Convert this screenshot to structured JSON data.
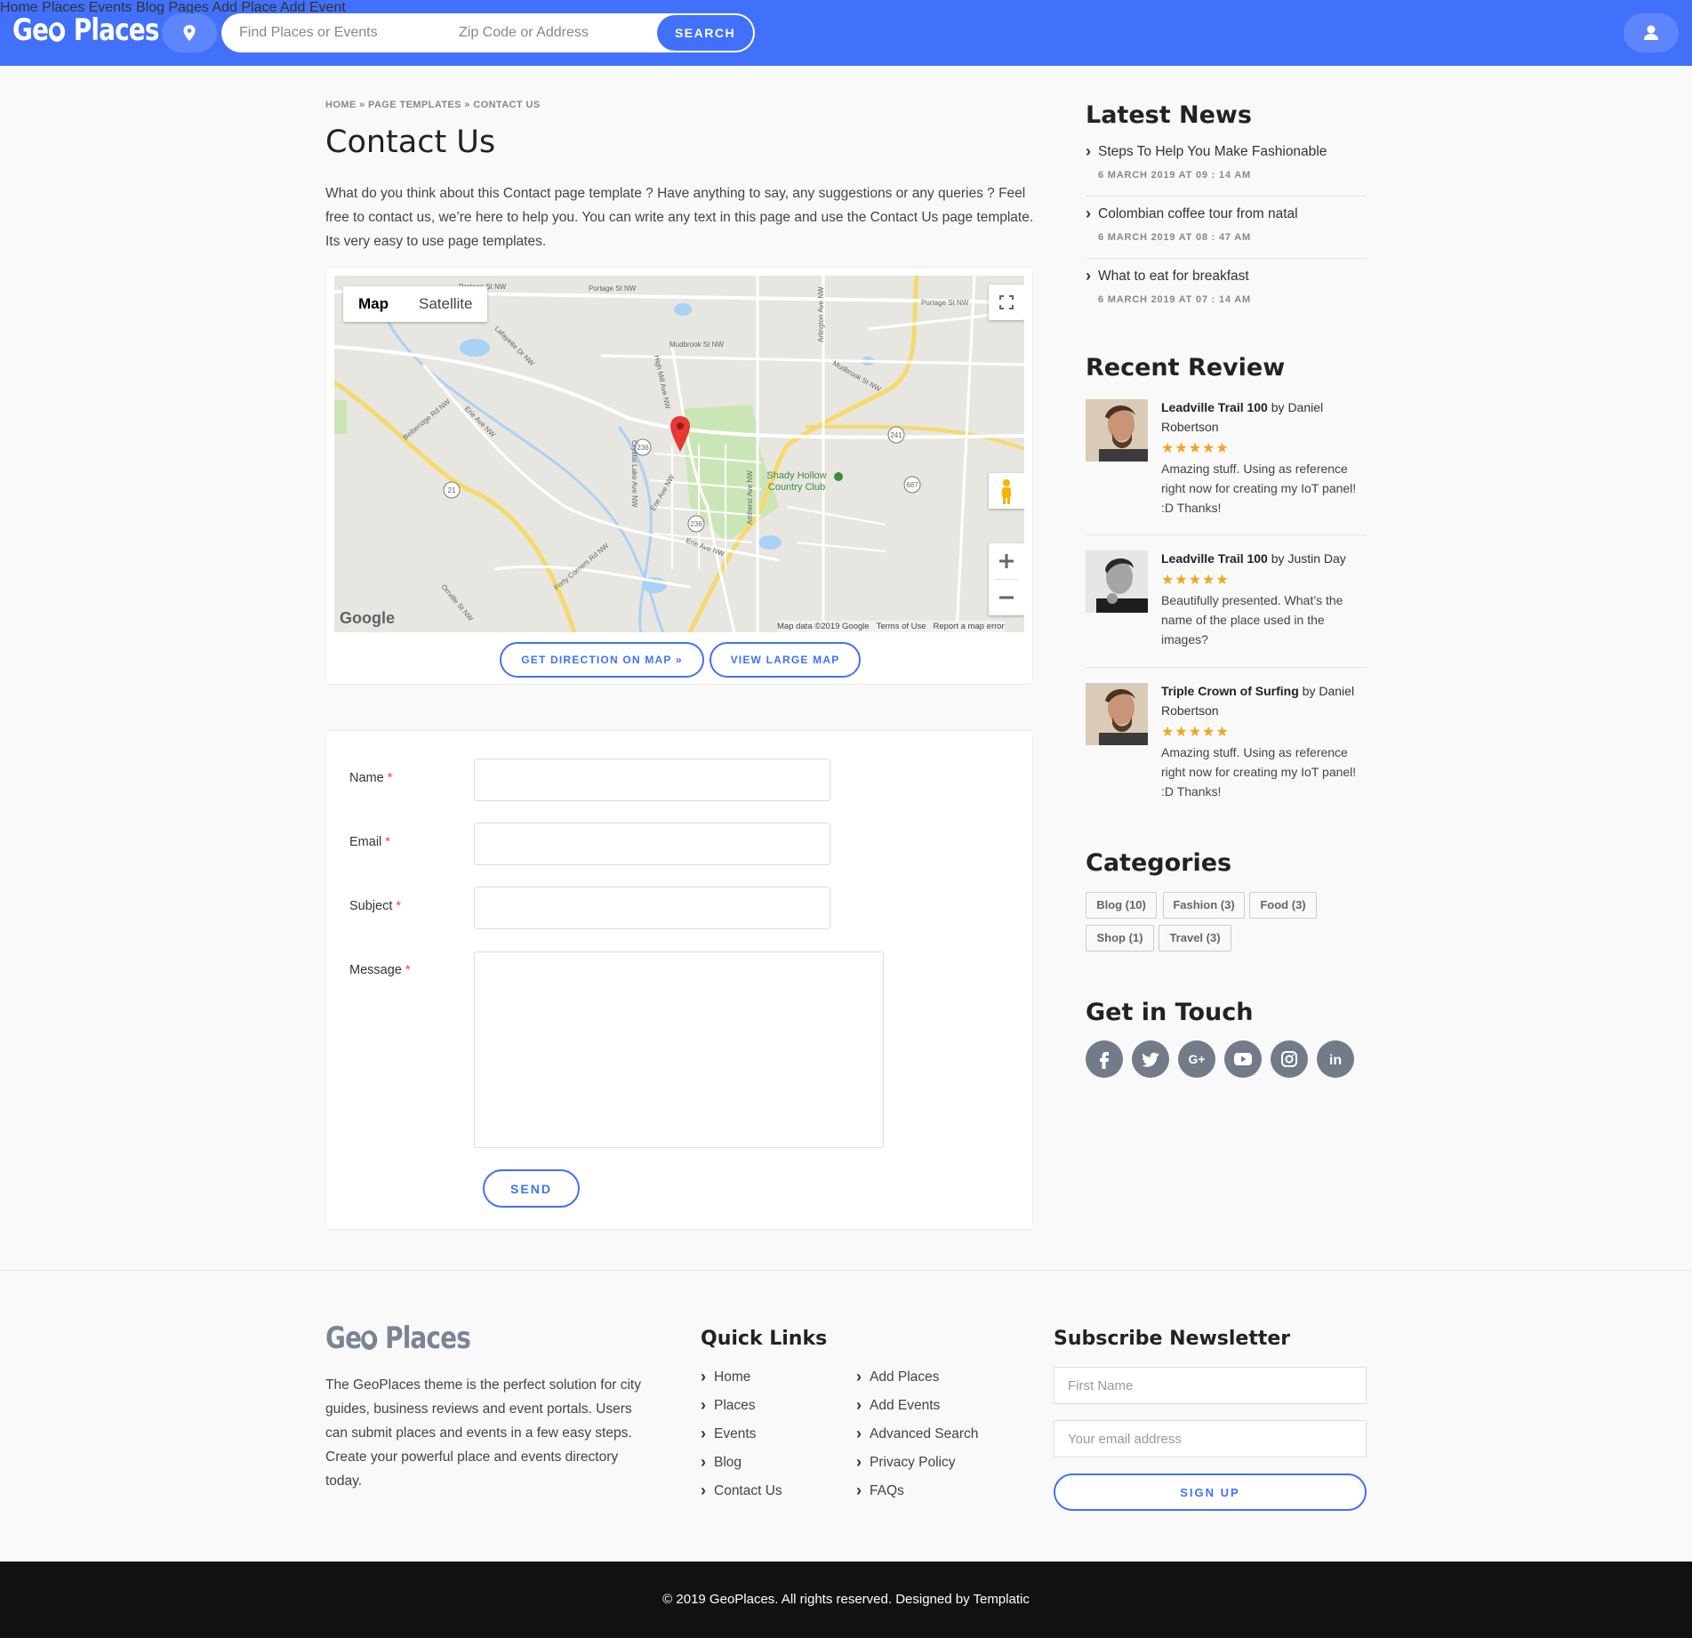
{
  "brand": {
    "logo_left": "Ge",
    "logo_right": "Places"
  },
  "search": {
    "what_placeholder": "Find Places or Events",
    "where_placeholder": "Zip Code or Address",
    "button": "SEARCH"
  },
  "nav": [
    "Home",
    "Places",
    "Events",
    "Blog",
    "Pages",
    "Add Place",
    "Add Event"
  ],
  "breadcrumb": "HOME » PAGE TEMPLATES » CONTACT US",
  "page_title": "Contact Us",
  "intro": "What do you think about this Contact page template ? Have anything to say, any suggestions or any queries ? Feel free to contact us, we’re here to help you. You can write any text in this page and use the Contact Us page template. Its very easy to use page templates.",
  "map": {
    "tab_map": "Map",
    "tab_satellite": "Satellite",
    "place_label_1": "Shady Hollow",
    "place_label_2": "Country Club",
    "google": "Google",
    "attribution": "Map data ©2019 Google",
    "terms": "Terms of Use",
    "report": "Report a map error",
    "roads": [
      "Portage St NW",
      "Mudbrook St NW",
      "Lafayette Dr NW",
      "High Mill Ave NW",
      "Erie Ave NW",
      "Crystal Lake Ave NW",
      "Amherst Ave NW",
      "Forty Corners Rd NW",
      "Orrville St NW",
      "Arlington Ave NW",
      "Beiberidge Rd NW"
    ],
    "route_markers": [
      "241",
      "687",
      "236",
      "236",
      "21"
    ],
    "direction_button": "GET DIRECTION ON MAP »",
    "large_map_button": "VIEW LARGE MAP"
  },
  "form": {
    "name_label": "Name",
    "email_label": "Email",
    "subject_label": "Subject",
    "message_label": "Message",
    "required_mark": "*",
    "send": "SEND"
  },
  "sidebar": {
    "news_heading": "Latest News",
    "news": [
      {
        "title": "Steps To Help You Make Fashionable",
        "date": "6 MARCH 2019 AT 09 : 14 AM"
      },
      {
        "title": "Colombian coffee tour from natal",
        "date": "6 MARCH 2019 AT 08 : 47 AM"
      },
      {
        "title": "What to eat for breakfast",
        "date": "6 MARCH 2019 AT 07 : 14 AM"
      }
    ],
    "review_heading": "Recent Review",
    "reviews": [
      {
        "place": "Leadville Trail 100",
        "by": "by",
        "author": "Daniel Robertson",
        "stars": "★★★★★",
        "rating": 5,
        "text": "Amazing stuff. Using as reference right now for creating my IoT panel! :D Thanks!"
      },
      {
        "place": "Leadville Trail 100",
        "by": "by",
        "author": "Justin Day",
        "stars": "★★★★★",
        "rating": 5,
        "text": "Beautifully presented. What’s the name of the place used in the images?"
      },
      {
        "place": "Triple Crown of Surfing",
        "by": "by",
        "author": "Daniel Robertson",
        "stars": "★★★★★",
        "rating": 5,
        "text": "Amazing stuff. Using as reference right now for creating my IoT panel! :D Thanks!"
      }
    ],
    "categories_heading": "Categories",
    "categories": [
      "Blog (10)",
      "Fashion (3)",
      "Food (3)",
      "Shop (1)",
      "Travel (3)"
    ],
    "touch_heading": "Get in Touch",
    "social": [
      {
        "icon": "facebook-icon",
        "glyph": "f"
      },
      {
        "icon": "twitter-icon",
        "glyph": "t"
      },
      {
        "icon": "google-plus-icon",
        "glyph": "G+"
      },
      {
        "icon": "youtube-icon",
        "glyph": "▶"
      },
      {
        "icon": "instagram-icon",
        "glyph": "◎"
      },
      {
        "icon": "linkedin-icon",
        "glyph": "in"
      }
    ]
  },
  "footer": {
    "about": "The GeoPlaces theme is the perfect solution for city guides, business reviews and event portals. Users can submit places and events in a few easy steps. Create your powerful place and events directory today.",
    "quick_links_heading": "Quick Links",
    "links_col1": [
      "Home",
      "Places",
      "Events",
      "Blog",
      "Contact Us"
    ],
    "links_col2": [
      "Add Places",
      "Add Events",
      "Advanced Search",
      "Privacy Policy",
      "FAQs"
    ],
    "newsletter_heading": "Subscribe Newsletter",
    "first_name_placeholder": "First Name",
    "email_placeholder": "Your email address",
    "signup": "SIGN UP",
    "copyright": "© 2019 GeoPlaces. All rights reserved. Designed by Templatic"
  },
  "colors": {
    "primary": "#4170fb",
    "star": "#f2a51d",
    "social": "#727b87",
    "bottom_bar": "#111111"
  }
}
